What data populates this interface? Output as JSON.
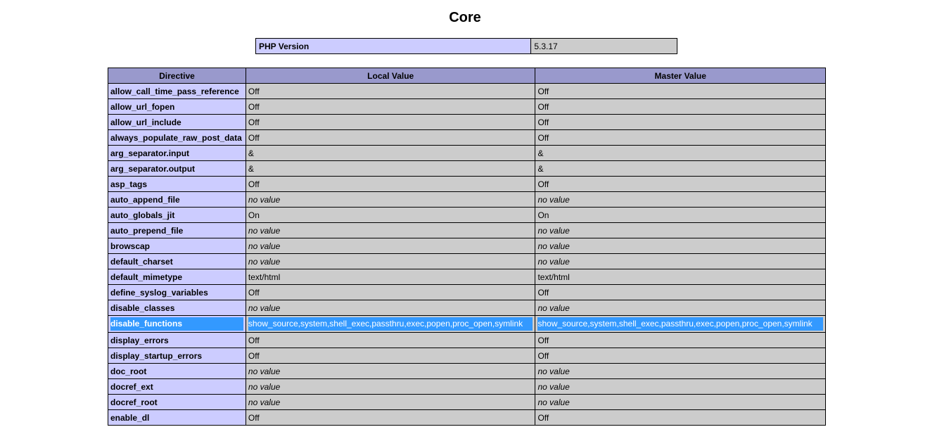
{
  "section": {
    "title": "Core"
  },
  "version": {
    "label": "PHP Version",
    "value": "5.3.17"
  },
  "headers": {
    "directive": "Directive",
    "local": "Local Value",
    "master": "Master Value"
  },
  "rows": [
    {
      "directive": "allow_call_time_pass_reference",
      "local": "Off",
      "master": "Off",
      "no_value": false,
      "selected": false
    },
    {
      "directive": "allow_url_fopen",
      "local": "Off",
      "master": "Off",
      "no_value": false,
      "selected": false
    },
    {
      "directive": "allow_url_include",
      "local": "Off",
      "master": "Off",
      "no_value": false,
      "selected": false
    },
    {
      "directive": "always_populate_raw_post_data",
      "local": "Off",
      "master": "Off",
      "no_value": false,
      "selected": false
    },
    {
      "directive": "arg_separator.input",
      "local": "&",
      "master": "&",
      "no_value": false,
      "selected": false
    },
    {
      "directive": "arg_separator.output",
      "local": "&",
      "master": "&",
      "no_value": false,
      "selected": false
    },
    {
      "directive": "asp_tags",
      "local": "Off",
      "master": "Off",
      "no_value": false,
      "selected": false
    },
    {
      "directive": "auto_append_file",
      "local": "no value",
      "master": "no value",
      "no_value": true,
      "selected": false
    },
    {
      "directive": "auto_globals_jit",
      "local": "On",
      "master": "On",
      "no_value": false,
      "selected": false
    },
    {
      "directive": "auto_prepend_file",
      "local": "no value",
      "master": "no value",
      "no_value": true,
      "selected": false
    },
    {
      "directive": "browscap",
      "local": "no value",
      "master": "no value",
      "no_value": true,
      "selected": false
    },
    {
      "directive": "default_charset",
      "local": "no value",
      "master": "no value",
      "no_value": true,
      "selected": false
    },
    {
      "directive": "default_mimetype",
      "local": "text/html",
      "master": "text/html",
      "no_value": false,
      "selected": false
    },
    {
      "directive": "define_syslog_variables",
      "local": "Off",
      "master": "Off",
      "no_value": false,
      "selected": false
    },
    {
      "directive": "disable_classes",
      "local": "no value",
      "master": "no value",
      "no_value": true,
      "selected": false
    },
    {
      "directive": "disable_functions",
      "local": "show_source,system,shell_exec,passthru,exec,popen,proc_open,symlink",
      "master": "show_source,system,shell_exec,passthru,exec,popen,proc_open,symlink",
      "no_value": false,
      "selected": true
    },
    {
      "directive": "display_errors",
      "local": "Off",
      "master": "Off",
      "no_value": false,
      "selected": false
    },
    {
      "directive": "display_startup_errors",
      "local": "Off",
      "master": "Off",
      "no_value": false,
      "selected": false
    },
    {
      "directive": "doc_root",
      "local": "no value",
      "master": "no value",
      "no_value": true,
      "selected": false
    },
    {
      "directive": "docref_ext",
      "local": "no value",
      "master": "no value",
      "no_value": true,
      "selected": false
    },
    {
      "directive": "docref_root",
      "local": "no value",
      "master": "no value",
      "no_value": true,
      "selected": false
    },
    {
      "directive": "enable_dl",
      "local": "Off",
      "master": "Off",
      "no_value": false,
      "selected": false
    }
  ]
}
